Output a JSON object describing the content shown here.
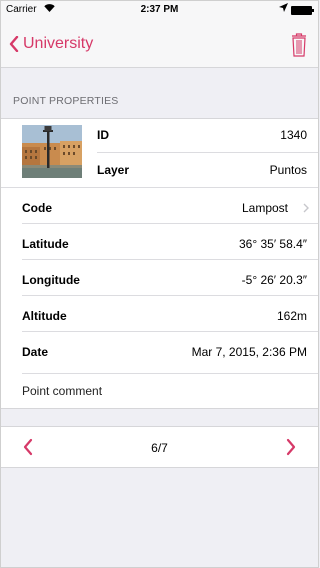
{
  "status": {
    "carrier": "Carrier",
    "time": "2:37 PM"
  },
  "nav": {
    "back_label": "University"
  },
  "section": {
    "header": "POINT PROPERTIES"
  },
  "fields": {
    "id_label": "ID",
    "id_value": "1340",
    "layer_label": "Layer",
    "layer_value": "Puntos",
    "code_label": "Code",
    "code_value": "Lampost",
    "latitude_label": "Latitude",
    "latitude_value": "36° 35′ 58.4″",
    "longitude_label": "Longitude",
    "longitude_value": "-5° 26′ 20.3″",
    "altitude_label": "Altitude",
    "altitude_value": "162m",
    "date_label": "Date",
    "date_value": "Mar 7, 2015, 2:36 PM",
    "comment_placeholder": "Point comment"
  },
  "pager": {
    "count": "6/7"
  },
  "colors": {
    "accent": "#d63968",
    "background": "#efeff4",
    "separator": "#dcdce0"
  },
  "icons": {
    "back": "chevron-left-icon",
    "delete": "trash-icon",
    "prev": "chevron-left-icon",
    "next": "chevron-right-icon",
    "disclosure": "chevron-right-icon",
    "wifi": "wifi-icon",
    "location": "location-arrow-icon",
    "battery": "battery-icon"
  }
}
